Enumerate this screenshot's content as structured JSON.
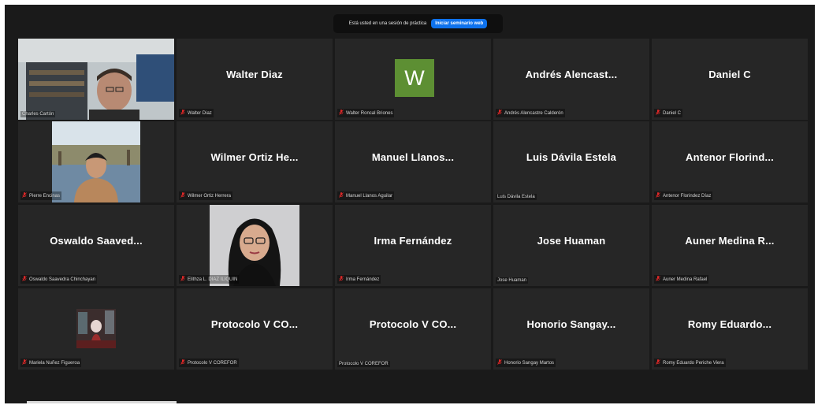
{
  "banner": {
    "message": "Está usted en una sesión de práctica",
    "button_label": "Iniciar seminario web"
  },
  "tiles": [
    {
      "name": "",
      "label": "Charles Cartón",
      "muted": false
    },
    {
      "name": "Walter Diaz",
      "label": "Walter Diaz",
      "muted": true
    },
    {
      "name": "",
      "label": "Walter Roncal Briones",
      "muted": true,
      "avatar_letter": "W"
    },
    {
      "name": "Andrés  Alencast...",
      "label": "Andrés Alencastre Calderón",
      "muted": true
    },
    {
      "name": "Daniel C",
      "label": "Daniel C",
      "muted": true
    },
    {
      "name": "",
      "label": "Pierre Encinas",
      "muted": true
    },
    {
      "name": "Wilmer  Ortiz  He...",
      "label": "Wilmer Ortiz Herrera",
      "muted": true
    },
    {
      "name": "Manuel  Llanos...",
      "label": "Manuel Llanos Aguilar",
      "muted": true
    },
    {
      "name": "Luis Dávila Estela",
      "label": "Luis Dávila Estela",
      "muted": false
    },
    {
      "name": "Antenor  Florind...",
      "label": "Antenor Florindez Díaz",
      "muted": true
    },
    {
      "name": "Oswaldo  Saaved...",
      "label": "Oswaldo Saavedra Chinchayan",
      "muted": true
    },
    {
      "name": "",
      "label": "Elithza L. DIAZ ILIQUIN",
      "muted": true
    },
    {
      "name": "Irma Fernández",
      "label": "Irma Fernández",
      "muted": true
    },
    {
      "name": "Jose Huaman",
      "label": "Jose Huaman",
      "muted": false
    },
    {
      "name": "Auner  Medina  R...",
      "label": "Auner Medina Rafael",
      "muted": true
    },
    {
      "name": "",
      "label": "Mariela Nuñez Figueroa",
      "muted": true
    },
    {
      "name": "Protocolo  V  CO...",
      "label": "Protocolo V COREFOR",
      "muted": true
    },
    {
      "name": "Protocolo  V  CO...",
      "label": "Protocolo V COREFOR",
      "muted": false
    },
    {
      "name": "Honorio  Sangay...",
      "label": "Honorio Sangay Martos",
      "muted": true
    },
    {
      "name": "Romy  Eduardo...",
      "label": "Romy Eduardo Periche Viera",
      "muted": true
    }
  ],
  "colors": {
    "tile_bg": "#262626",
    "active_speaker": "#c4de6a",
    "muted_icon": "#e02828",
    "avatar_bg": "#5d8f33",
    "button": "#0e72ed"
  }
}
